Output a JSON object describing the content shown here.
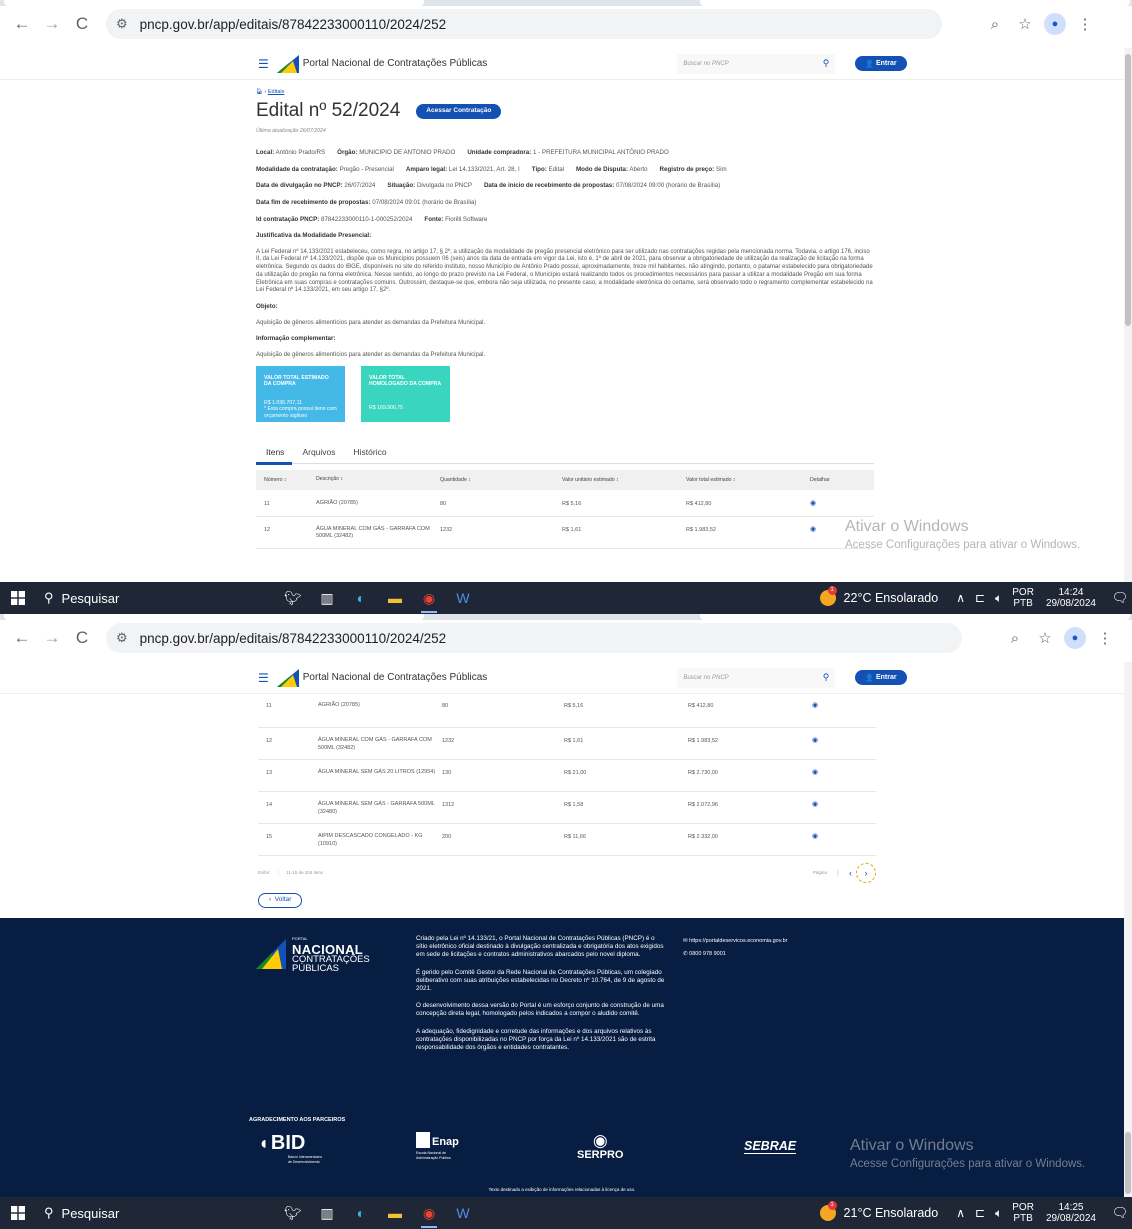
{
  "browser": {
    "url": "pncp.gov.br/app/editais/87842233000110/2024/252"
  },
  "header": {
    "portal_name": "Portal Nacional de Contratações Públicas",
    "search_placeholder": "Buscar no PNCP",
    "login_label": "Entrar"
  },
  "breadcrumb": {
    "home": "",
    "current": "Editais"
  },
  "edital": {
    "title": "Edital nº 52/2024",
    "access_button": "Acessar Contratação",
    "updated": "Última atualização 26/07/2024",
    "fields": {
      "local_label": "Local:",
      "local": "Antônio Prado/RS",
      "orgao_label": "Órgão:",
      "orgao": "MUNICIPIO DE ANTONIO PRADO",
      "unidade_label": "Unidade compradora:",
      "unidade": "1 - PREFEITURA MUNICIPAL ANTÔNIO PRADO",
      "modalidade_label": "Modalidade da contratação:",
      "modalidade": "Pregão - Presencial",
      "amparo_label": "Amparo legal:",
      "amparo": "Lei 14.133/2021, Art. 28, I",
      "tipo_label": "Tipo:",
      "tipo": "Edital",
      "disputa_label": "Modo de Disputa:",
      "disputa": "Aberto",
      "registro_label": "Registro de preço:",
      "registro": "Sim",
      "divulgacao_label": "Data de divulgação no PNCP:",
      "divulgacao": "26/07/2024",
      "situacao_label": "Situação:",
      "situacao": "Divulgada no PNCP",
      "inicio_label": "Data de início de recebimento de propostas:",
      "inicio": "07/08/2024 09:00 (horário de Brasília)",
      "fim_label": "Data fim de recebimento de propostas:",
      "fim": "07/08/2024 09:01 (horário de Brasília)",
      "id_label": "Id contratação PNCP:",
      "id": "87842233000110-1-000252/2024",
      "fonte_label": "Fonte:",
      "fonte": "Fiorilli Software"
    },
    "justificativa_title": "Justificativa da Modalidade Presencial:",
    "justificativa": "A Lei Federal nº 14.133/2021 estabeleceu, como regra, no artigo 17, § 2º, a utilização da modalidade de pregão presencial eletrônico para ser utilizado nas contratações regidas pela mencionada norma. Todavia, o artigo 176, inciso II, da Lei Federal nº 14.133/2021, dispõe que os Municípios possuem 06 (seis) anos da data de entrada em vigor da Lei, isto é, 1º de abril de 2021, para observar a obrigatoriedade de utilização da realização de licitação na forma eletrônica. Segundo os dados do IBGE, disponíveis no site do referido instituto, nosso Município de Antônio Prado possui, aproximadamente, treze mil habitantes, não atingindo, portanto, o patamar estabelecido para obrigatoriedade da utilização do pregão na forma eletrônica. Nesse sentido, ao longo do prazo previsto na Lei Federal, o Município estará realizando todos os procedimentos necessários para passar a utilizar a modalidade Pregão em sua forma Eletrônica em suas compras e contratações comuns. Outrossim, destaque-se que, embora não seja utilizada, no presente caso, a modalidade eletrônica do certame, será observado todo o regramento complementar estabelecido na Lei Federal nº 14.133/2021, em seu artigo 17, §2º.",
    "objeto_title": "Objeto:",
    "objeto": "Aquisição de gêneros alimentícios para atender as demandas da Prefeitura Municipal.",
    "info_title": "Informação complementar:",
    "info": "Aquisição de gêneros alimentícios para atender as demandas da Prefeitura Municipal."
  },
  "cards": {
    "estimado_title": "VALOR TOTAL ESTIMADO DA COMPRA",
    "estimado_value": "R$ 1.036.707,11",
    "estimado_note": "* Esta compra possui itens com orçamento sigiloso",
    "homologado_title": "VALOR TOTAL HOMOLOGADO DA COMPRA",
    "homologado_value": "R$ 169.900,75"
  },
  "tabs": [
    "Itens",
    "Arquivos",
    "Histórico"
  ],
  "table": {
    "headers": [
      "Número",
      "Descrição",
      "Quantidade",
      "Valor unitário estimado",
      "Valor total estimado",
      "Detalhar"
    ],
    "rows_top": [
      {
        "num": "11",
        "desc": "AGRIÃO (20785)",
        "qtd": "80",
        "unit": "R$ 5,16",
        "total": "R$ 412,80"
      },
      {
        "num": "12",
        "desc": "ÁGUA MINERAL COM GÁS - GARRAFA COM 500ML (32482)",
        "qtd": "1232",
        "unit": "R$ 1,61",
        "total": "R$ 1.983,52"
      }
    ],
    "rows": [
      {
        "num": "11",
        "desc": "AGRIÃO (20785)",
        "qtd": "80",
        "unit": "R$ 5,16",
        "total": "R$ 412,80"
      },
      {
        "num": "12",
        "desc": "ÁGUA MINERAL COM GÁS - GARRAFA COM 500ML (32482)",
        "qtd": "1232",
        "unit": "R$ 1,61",
        "total": "R$ 1.983,52"
      },
      {
        "num": "13",
        "desc": "ÁGUA MINERAL SEM GÁS 20 LITROS (12954)",
        "qtd": "130",
        "unit": "R$ 21,00",
        "total": "R$ 2.730,00"
      },
      {
        "num": "14",
        "desc": "ÁGUA MINERAL SEM GÁS - GARRAFA 500ML (32480)",
        "qtd": "1312",
        "unit": "R$ 1,58",
        "total": "R$ 2.072,96"
      },
      {
        "num": "15",
        "desc": "AIPIM DESCASCADO CONGELADO - KG (10910)",
        "qtd": "200",
        "unit": "R$ 11,66",
        "total": "R$ 2.332,00"
      }
    ],
    "exibir_label": "Exibir:",
    "range_text": "11-15 de 204 itens",
    "page_label": "Página",
    "back_button": "Voltar"
  },
  "footer": {
    "logo_small": "PORTAL",
    "logo_big": "NACIONAL",
    "logo_l2": "CONTRATAÇÕES",
    "logo_l3": "PÚBLICAS",
    "p1": "Criado pela Lei nº 14.133/21, o Portal Nacional de Contratações Públicas (PNCP) é o sítio eletrônico oficial destinado à divulgação centralizada e obrigatória dos atos exigidos em sede de licitações e contratos administrativos abarcados pelo novel diploma.",
    "p2": "É gerido pelo Comitê Gestor da Rede Nacional de Contratações Públicas, um colegiado deliberativo com suas atribuições estabelecidas no Decreto nº 10.764, de 9 de agosto de 2021.",
    "p3": "O desenvolvimento dessa versão do Portal é um esforço conjunto de construção de uma concepção direta legal, homologado pelos indicados a compor o aludido comitê.",
    "p4": "A adequação, fidedignidade e corretude das informações e dos arquivos relativos às contratações disponibilizadas no PNCP por força da Lei nº 14.133/2021 são de estrita responsabilidade dos órgãos e entidades contratantes.",
    "contact_url": "https://portaldeservicos.economia.gov.br",
    "contact_phone": "0800 978 9001",
    "partners_title": "AGRADECIMENTO AOS PARCEIROS",
    "bid": "BID",
    "bid_sub1": "Banco Interamericano",
    "bid_sub2": "de Desenvolvimento",
    "enap": "Enap",
    "enap_sub1": "Escola Nacional de",
    "enap_sub2": "Administração Pública",
    "serpro": "SERPRO",
    "sebrae": "SEBRAE",
    "bottom": "Texto destinado a exibição de informações relacionadas à licença de uso."
  },
  "windows": {
    "activate_title": "Ativar o Windows",
    "activate_sub": "Acesse Configurações para ativar o Windows."
  },
  "taskbar1": {
    "search": "Pesquisar",
    "weather": "22°C  Ensolarado",
    "lang1": "POR",
    "lang2": "PTB",
    "time": "14:24",
    "date": "29/08/2024"
  },
  "taskbar2": {
    "search": "Pesquisar",
    "weather": "21°C  Ensolarado",
    "lang1": "POR",
    "lang2": "PTB",
    "time": "14:25",
    "date": "29/08/2024"
  }
}
